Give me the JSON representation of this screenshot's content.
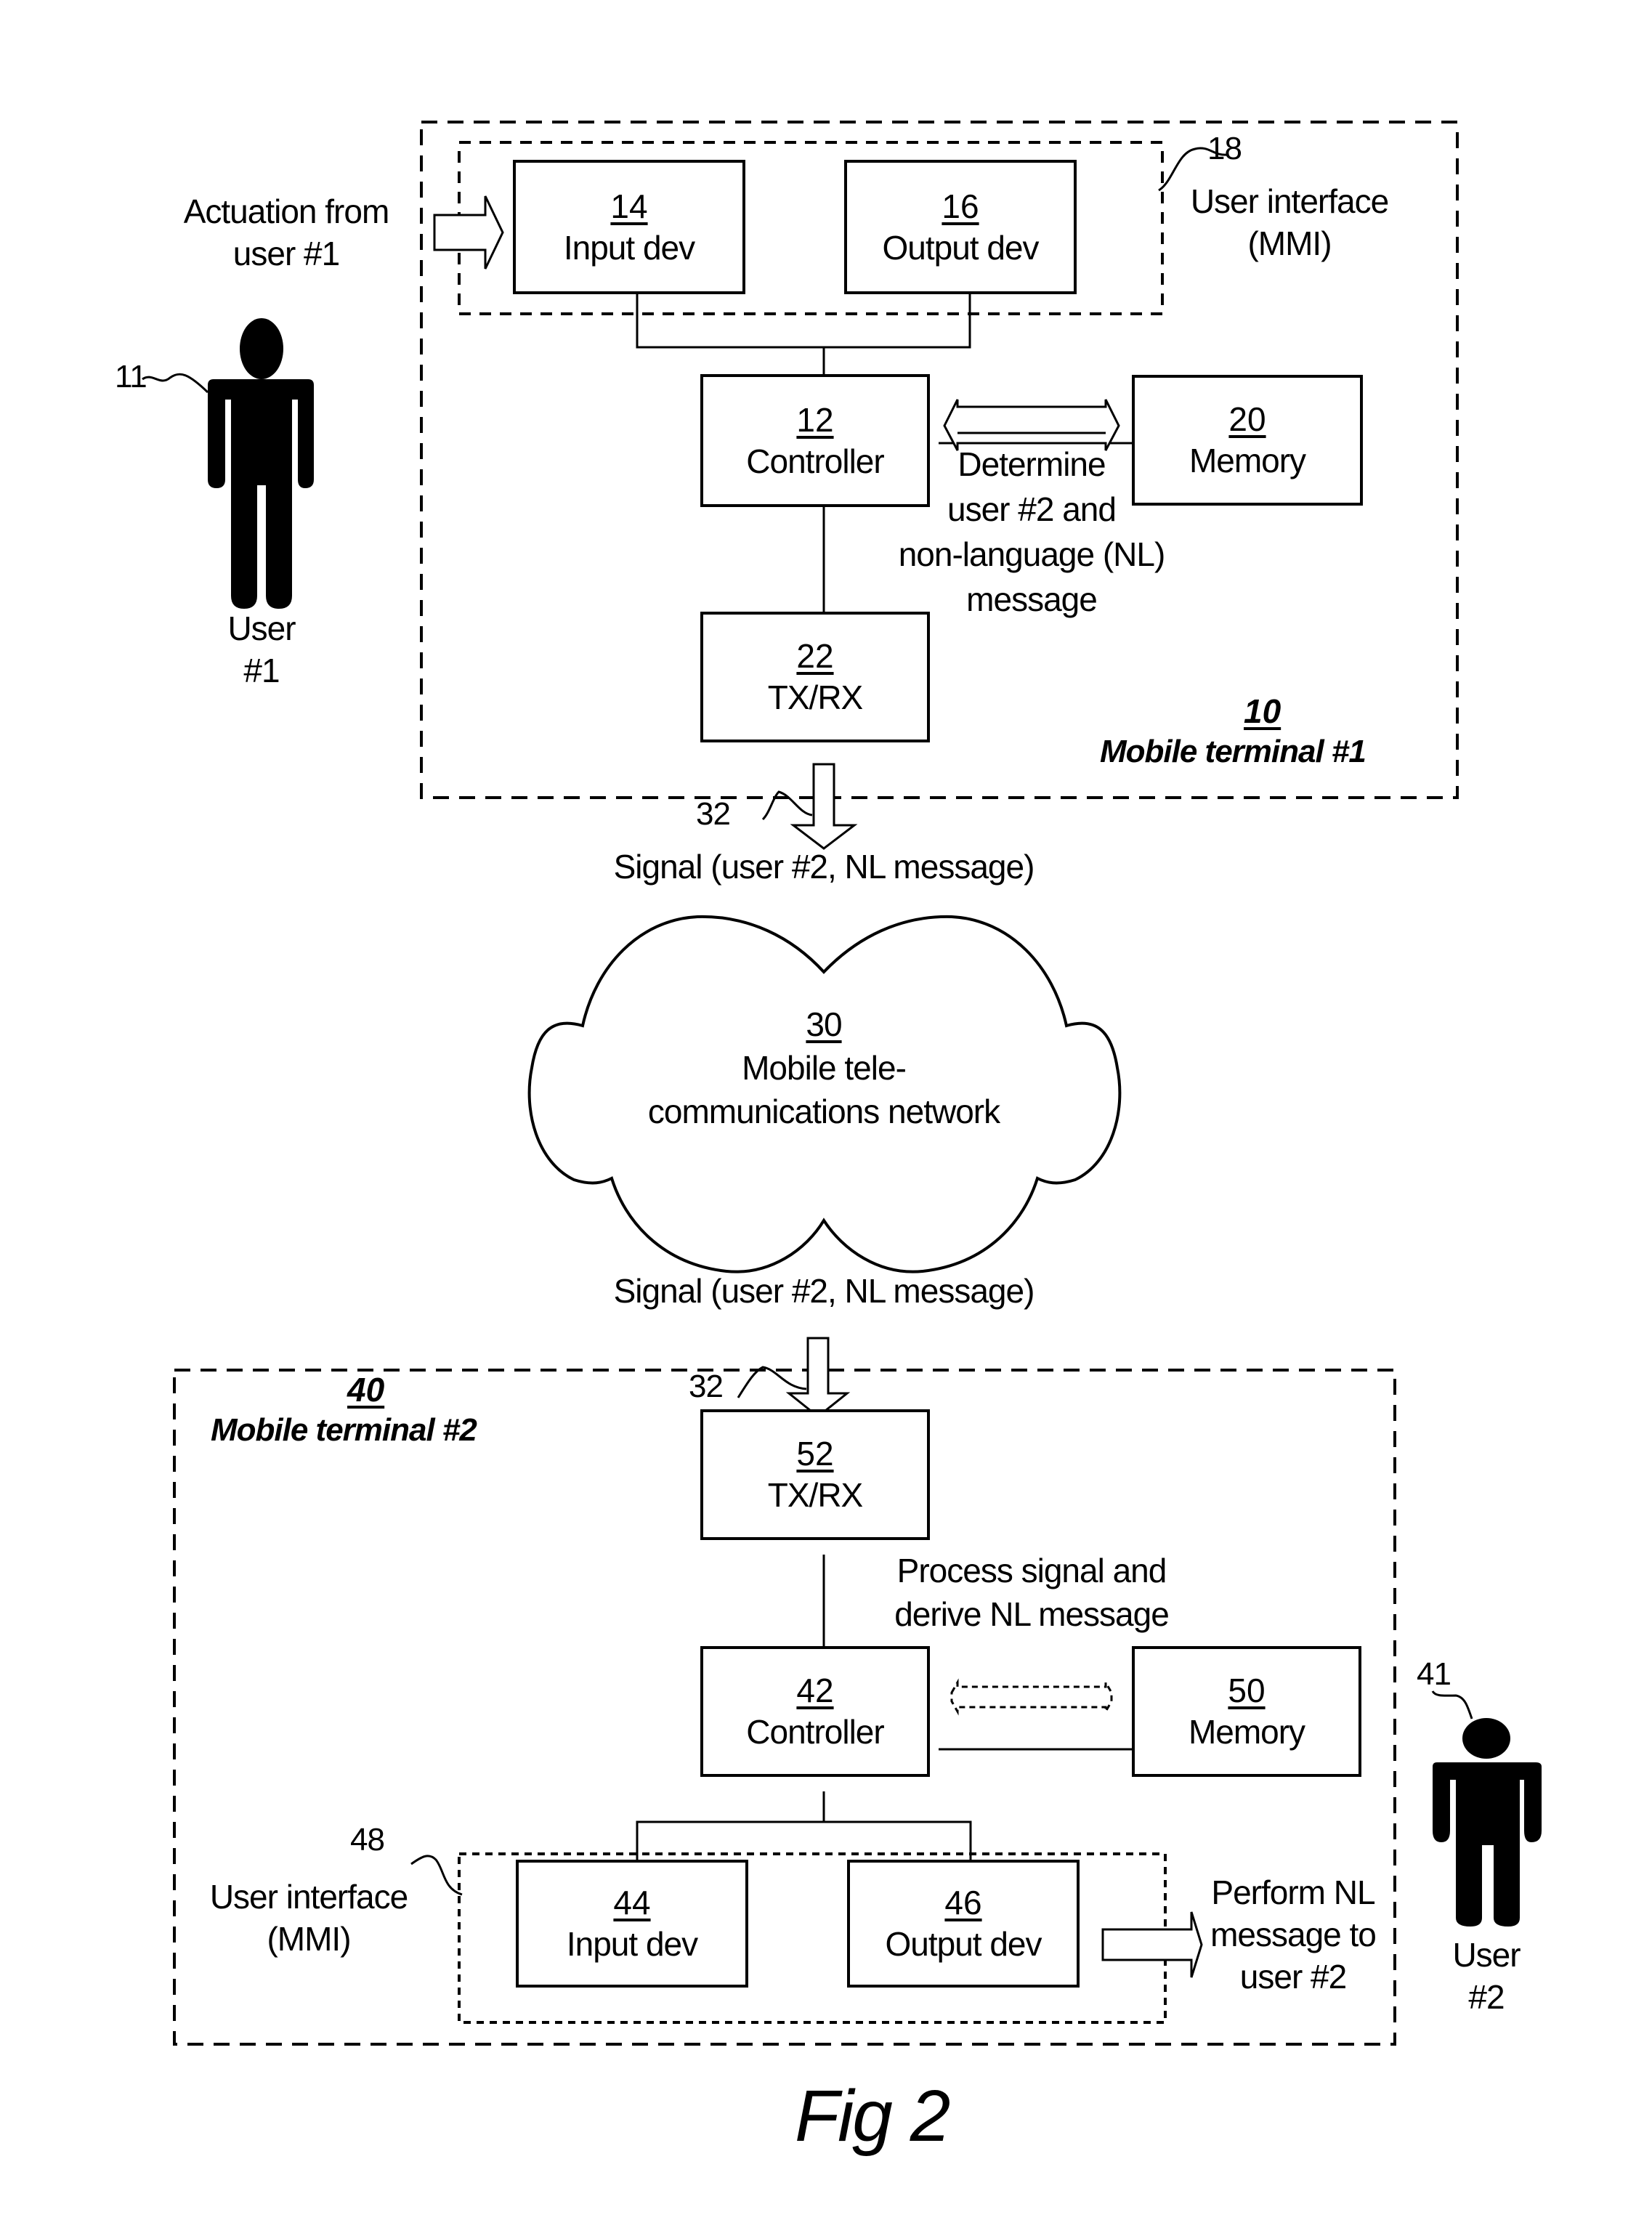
{
  "figure": {
    "caption": "Fig 2"
  },
  "user1": {
    "ref": "11",
    "label_line1": "User",
    "label_line2": "#1",
    "actuation_line1": "Actuation from",
    "actuation_line2": "user #1"
  },
  "terminal1": {
    "ref": "10",
    "name": "Mobile terminal #1",
    "user_interface": {
      "ref": "18",
      "label_line1": "User interface",
      "label_line2": "(MMI)"
    },
    "blocks": {
      "input": {
        "num": "14",
        "name": "Input dev"
      },
      "output": {
        "num": "16",
        "name": "Output dev"
      },
      "controller": {
        "num": "12",
        "name": "Controller"
      },
      "memory": {
        "num": "20",
        "name": "Memory"
      },
      "txrx": {
        "num": "22",
        "name": "TX/RX"
      }
    },
    "annotation_lines": [
      "Determine",
      "user #2 and",
      "non-language (NL)",
      "message"
    ]
  },
  "signal": {
    "ref_top": "32",
    "ref_bottom": "32",
    "label_top": "Signal (user #2, NL message)",
    "label_bottom": "Signal (user #2, NL message)"
  },
  "network": {
    "num": "30",
    "line1": "Mobile tele-",
    "line2": "communications network"
  },
  "terminal2": {
    "ref": "40",
    "name": "Mobile terminal #2",
    "user_interface": {
      "ref": "48",
      "label_line1": "User interface",
      "label_line2": "(MMI)"
    },
    "blocks": {
      "txrx": {
        "num": "52",
        "name": "TX/RX"
      },
      "controller": {
        "num": "42",
        "name": "Controller"
      },
      "memory": {
        "num": "50",
        "name": "Memory"
      },
      "input": {
        "num": "44",
        "name": "Input dev"
      },
      "output": {
        "num": "46",
        "name": "Output dev"
      }
    },
    "annotation_lines": [
      "Process signal and",
      "derive NL message"
    ],
    "perform_lines": [
      "Perform NL",
      "message to",
      "user #2"
    ]
  },
  "user2": {
    "ref": "41",
    "label_line1": "User",
    "label_line2": "#2"
  }
}
